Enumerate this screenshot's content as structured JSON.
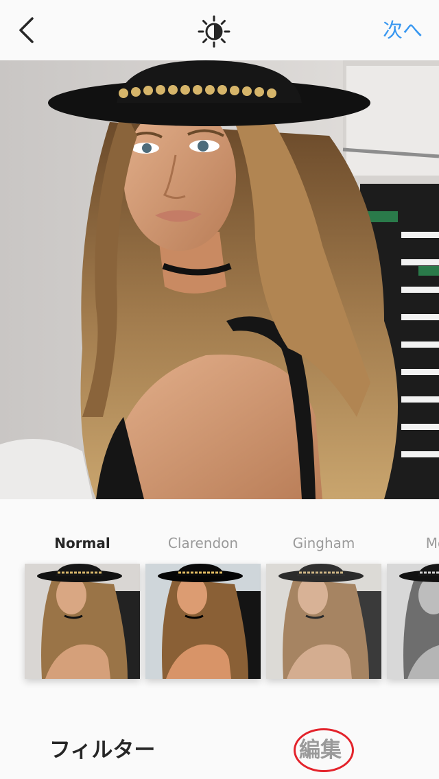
{
  "nav": {
    "back_icon": "chevron-left-icon",
    "lux_icon": "lux-adjust-icon",
    "next_label": "次へ"
  },
  "photo": {
    "description_icon": "portrait-photo"
  },
  "filters": [
    {
      "name": "Normal",
      "active": true
    },
    {
      "name": "Clarendon",
      "active": false
    },
    {
      "name": "Gingham",
      "active": false
    },
    {
      "name": "Moon",
      "active": false
    }
  ],
  "tabs": {
    "filter_label": "フィルター",
    "edit_label": "編集"
  },
  "colors": {
    "accent": "#3897f0",
    "annotation_circle": "#e3232b",
    "text_primary": "#262626",
    "text_secondary": "#9a9a9a"
  }
}
